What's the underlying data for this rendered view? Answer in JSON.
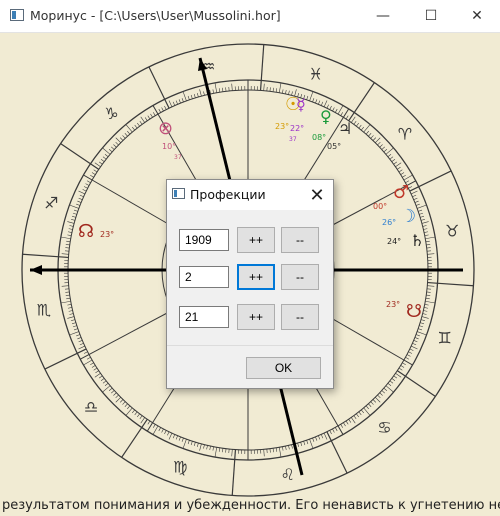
{
  "window": {
    "title": "Моринус - [C:\\Users\\User\\Mussolini.hor]",
    "icon": "app-icon",
    "controls": {
      "minimize": "—",
      "maximize": "☐",
      "close": "✕"
    }
  },
  "chart": {
    "signs": [
      "♈",
      "♉",
      "♊",
      "♋",
      "♌",
      "♍",
      "♎",
      "♏",
      "♐",
      "♑",
      "♒",
      "♓"
    ],
    "planets": [
      {
        "id": "sun",
        "glyph": "☉",
        "degree": "23°",
        "minute": "",
        "color": "#d49a00"
      },
      {
        "id": "mercury",
        "glyph": "☿",
        "degree": "22°",
        "minute": "37",
        "color": "#9b30c8"
      },
      {
        "id": "venus",
        "glyph": "♀",
        "degree": "08°",
        "minute": "",
        "color": "#1a9a3a"
      },
      {
        "id": "jupiter",
        "glyph": "♃",
        "degree": "05°",
        "minute": "",
        "color": "#333333"
      },
      {
        "id": "fortune",
        "glyph": "⊗",
        "degree": "10°",
        "minute": "37",
        "color": "#c0507a"
      },
      {
        "id": "north-node",
        "glyph": "☊",
        "degree": "23°",
        "minute": "",
        "color": "#a0281e"
      },
      {
        "id": "mars",
        "glyph": "♂",
        "degree": "00°",
        "minute": "",
        "color": "#c0392b"
      },
      {
        "id": "moon",
        "glyph": "☽",
        "degree": "26°",
        "minute": "",
        "color": "#2f7fd0"
      },
      {
        "id": "saturn",
        "glyph": "♄",
        "degree": "24°",
        "minute": "",
        "color": "#222222"
      },
      {
        "id": "south-node",
        "glyph": "☋",
        "degree": "23°",
        "minute": "",
        "color": "#a0281e"
      }
    ]
  },
  "bottom_text": "результатом понимания и убежденности. Его ненависть к угнетению не была",
  "dialog": {
    "title": "Профекции",
    "rows": [
      {
        "value": "1909",
        "plus": "++",
        "minus": "--"
      },
      {
        "value": "2",
        "plus": "++",
        "minus": "--"
      },
      {
        "value": "21",
        "plus": "++",
        "minus": "--"
      }
    ],
    "ok_label": "OK",
    "close": "✕"
  }
}
